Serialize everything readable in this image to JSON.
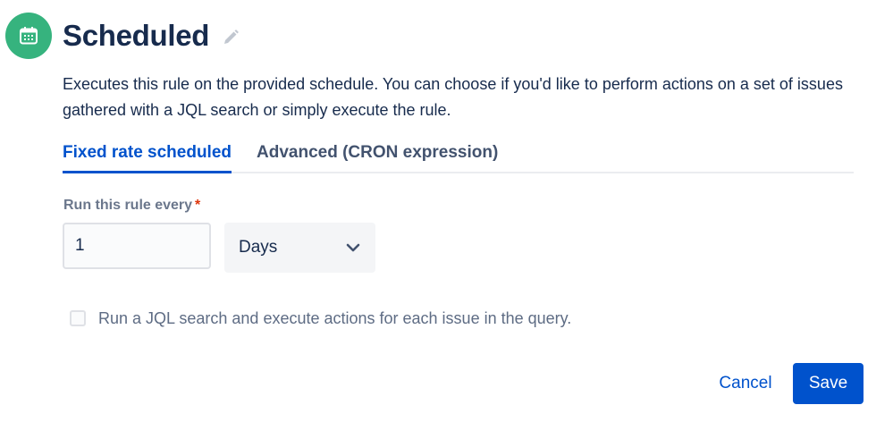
{
  "header": {
    "title": "Scheduled",
    "trigger_icon": "calendar-icon",
    "edit_icon": "pencil-icon",
    "icon_color": "#36b37e"
  },
  "description": "Executes this rule on the provided schedule. You can choose if you'd like to perform actions on a set of issues gathered with a JQL search or simply execute the rule.",
  "tabs": [
    {
      "label": "Fixed rate scheduled",
      "selected": true
    },
    {
      "label": "Advanced (CRON expression)",
      "selected": false
    }
  ],
  "form": {
    "interval_label": "Run this rule every",
    "required_marker": "*",
    "interval_value": "1",
    "unit_value": "Days",
    "jql_checkbox_label": "Run a JQL search and execute actions for each issue in the query.",
    "jql_checked": false
  },
  "actions": {
    "cancel_label": "Cancel",
    "save_label": "Save"
  },
  "colors": {
    "primary": "#0052cc",
    "text": "#172b4d",
    "required": "#de350b"
  }
}
